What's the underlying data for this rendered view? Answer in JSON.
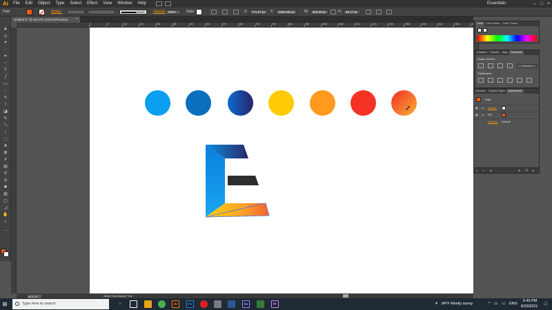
{
  "app": {
    "logo": "Ai",
    "workspace": "Essentials"
  },
  "menu": [
    "File",
    "Edit",
    "Object",
    "Type",
    "Select",
    "Effect",
    "View",
    "Window",
    "Help"
  ],
  "control_bar": {
    "object_type": "Path",
    "stroke_label": "Stroke:",
    "brush_label": "Basic",
    "opacity_label": "Opacity:",
    "opacity_value": "100%",
    "style_label": "Style:",
    "x_label": "X:",
    "x_value": "771.27 pt",
    "y_label": "Y:",
    "y_value": "1236.631 pt",
    "w_label": "W:",
    "w_value": "204.66 pt",
    "h_label": "H:",
    "h_value": "65.17 pt"
  },
  "document": {
    "tab_label": "Untitled-2* @ 66.67% (CMYK/Preview)",
    "close_glyph": "×"
  },
  "ruler": {
    "marks": [
      "0",
      "72",
      "144",
      "216",
      "288",
      "360",
      "432",
      "504",
      "576",
      "648",
      "720",
      "792",
      "864",
      "936",
      "1008",
      "1080",
      "1152",
      "1224",
      "1296",
      "1368",
      "1440",
      "1512",
      "1584",
      "1656",
      "1728",
      "1800",
      "1872",
      "1944"
    ]
  },
  "circles": [
    {
      "name": "circle-light-blue",
      "fill": "#0aa0ef"
    },
    {
      "name": "circle-dark-blue",
      "fill": "#0a6fbf"
    },
    {
      "name": "circle-blue-gradient",
      "fill": "linear-gradient(90deg,#0b6bd1,#2b2266)"
    },
    {
      "name": "circle-yellow",
      "fill": "#ffcb05"
    },
    {
      "name": "circle-orange",
      "fill": "#ff9a1e"
    },
    {
      "name": "circle-red",
      "fill": "#f53224"
    },
    {
      "name": "circle-red-yellow-gradient",
      "fill": "linear-gradient(135deg,#f02c2c,#fbb02f)"
    }
  ],
  "status": {
    "zoom": "66.67%",
    "tool": "Adobe Eyedropper Tool"
  },
  "panels": {
    "color_tabs": [
      "Color",
      "Color Guide",
      "Color Theme"
    ],
    "pathfinder_tabs": [
      "Gradient",
      "Transfor",
      "Align",
      "Pathfinder"
    ],
    "shape_modes_label": "Shape Modes:",
    "expand_label": "Expand",
    "pathfinders_label": "Pathfinders:",
    "appearance_tabs": [
      "Libraries",
      "Graphic Styles",
      "Appearance"
    ],
    "appearance": {
      "title": "Path",
      "stroke_label": "Stroke:",
      "fill_label": "Fill:",
      "opacity_label": "Opacity:",
      "opacity_value": "Default"
    }
  },
  "taskbar": {
    "search_placeholder": "Type here to search",
    "apps": [
      {
        "name": "taskbar-illustrator",
        "label": "Ai",
        "color": "#ff7c00"
      },
      {
        "name": "taskbar-photoshop",
        "label": "Ps",
        "color": "#1f8bd6"
      },
      {
        "name": "taskbar-aftereffects",
        "label": "Ae",
        "color": "#9b8bfe"
      },
      {
        "name": "taskbar-premiere",
        "label": "Pr",
        "color": "#c890ff"
      }
    ],
    "weather": "84°F  Mostly sunny",
    "language": "ENG",
    "time": "6:45 PM",
    "date": "8/23/2021"
  }
}
